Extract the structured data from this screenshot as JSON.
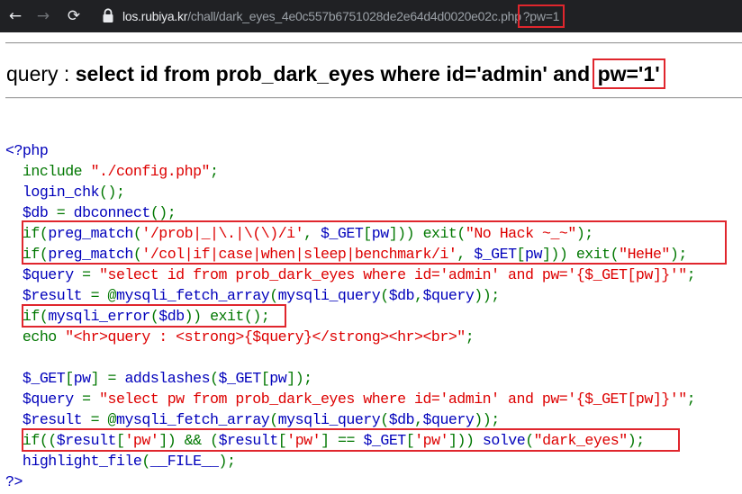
{
  "browser": {
    "url_host": "los.rubiya.kr",
    "url_path": "/chall/dark_eyes_4e0c557b6751028de2e64d4d0020e02c.php",
    "url_query": "?pw=1",
    "icons": {
      "back": "back-arrow-icon",
      "forward": "forward-arrow-icon",
      "reload": "reload-icon",
      "lock": "lock-icon"
    },
    "colors": {
      "bar": "#202124",
      "highlight": "#e0262d"
    }
  },
  "query_display": {
    "prefix": "query : ",
    "strong_main": "select id from prob_dark_eyes where id='admin' and ",
    "strong_pw": "pw='1'"
  },
  "code_lines": [
    "<?php",
    "  include \"./config.php\";",
    "  login_chk();",
    "  $db = dbconnect();",
    "  if(preg_match('/prob|_|\\.|\\(\\)/i', $_GET[pw])) exit(\"No Hack ~_~\");",
    "  if(preg_match('/col|if|case|when|sleep|benchmark/i', $_GET[pw])) exit(\"HeHe\");",
    "  $query = \"select id from prob_dark_eyes where id='admin' and pw='{$_GET[pw]}'\";",
    "  $result = @mysqli_fetch_array(mysqli_query($db,$query));",
    "  if(mysqli_error($db)) exit();",
    "  echo \"<hr>query : <strong>{$query}</strong><hr><br>\";",
    "",
    "  $_GET[pw] = addslashes($_GET[pw]);",
    "  $query = \"select pw from prob_dark_eyes where id='admin' and pw='{$_GET[pw]}'\";",
    "  $result = @mysqli_fetch_array(mysqli_query($db,$query));",
    "  if(($result['pw']) && ($result['pw'] == $_GET['pw'])) solve(\"dark_eyes\");",
    "  highlight_file(__FILE__);",
    "?>"
  ]
}
